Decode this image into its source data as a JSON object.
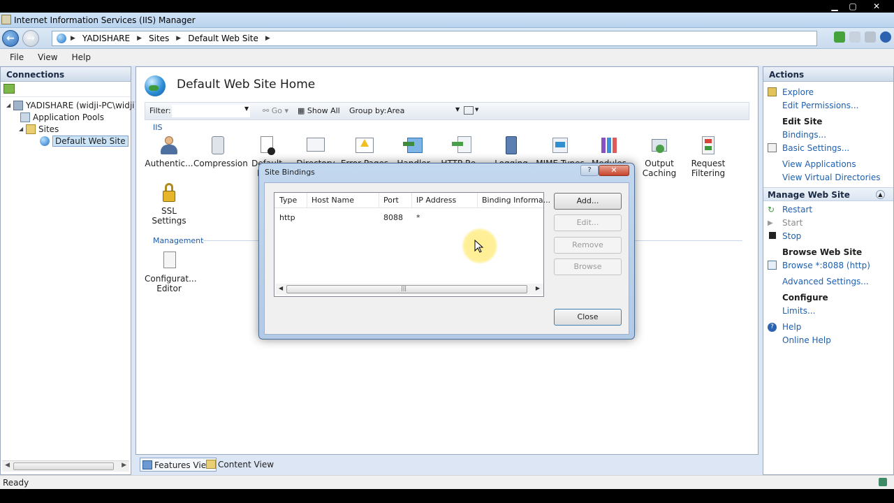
{
  "window": {
    "title": "Internet Information Services (IIS) Manager",
    "minimize": "▁",
    "maximize": "▢",
    "close": "✕"
  },
  "address": {
    "crumbs": [
      "YADISHARE",
      "Sites",
      "Default Web Site"
    ],
    "separator": "▶"
  },
  "menu": [
    "File",
    "View",
    "Help"
  ],
  "connections": {
    "header": "Connections",
    "tree": [
      {
        "label": "YADISHARE (widji-PC\\widji)",
        "icon": "server-icon"
      },
      {
        "label": "Application Pools",
        "icon": "app-pools-icon"
      },
      {
        "label": "Sites",
        "icon": "sites-folder-icon"
      },
      {
        "label": "Default Web Site",
        "icon": "globe-icon",
        "selected": true
      }
    ]
  },
  "center": {
    "title": "Default Web Site Home",
    "filter_label": "Filter:",
    "go_label": "Go",
    "show_all_label": "Show All",
    "group_by_label": "Group by:",
    "group_by_value": "Area",
    "sections": {
      "iis": "IIS",
      "management": "Management"
    },
    "features": [
      {
        "label": "Authentic...",
        "icon": "authentication-icon"
      },
      {
        "label": "Compression",
        "icon": "compression-icon"
      },
      {
        "label": "Default Do...",
        "icon": "default-document-icon"
      },
      {
        "label": "Directory Browsing",
        "icon": "directory-browsing-icon"
      },
      {
        "label": "Error Pages",
        "icon": "error-pages-icon"
      },
      {
        "label": "Handler Mappings",
        "icon": "handler-mappings-icon"
      },
      {
        "label": "HTTP Re...",
        "icon": "http-response-icon"
      },
      {
        "label": "Logging",
        "icon": "logging-icon"
      },
      {
        "label": "MIME Types",
        "icon": "mime-types-icon"
      },
      {
        "label": "Modules",
        "icon": "modules-icon"
      },
      {
        "label": "Output Caching",
        "icon": "output-caching-icon"
      },
      {
        "label": "Request Filtering",
        "icon": "request-filtering-icon"
      },
      {
        "label": "SSL Settings",
        "icon": "ssl-lock-icon"
      }
    ],
    "management_features": [
      {
        "label": "Configurat... Editor",
        "icon": "configuration-editor-icon"
      }
    ],
    "tabs": {
      "features_view": "Features View",
      "content_view": "Content View"
    }
  },
  "actions": {
    "header": "Actions",
    "explore": "Explore",
    "edit_permissions": "Edit Permissions...",
    "edit_site_heading": "Edit Site",
    "bindings": "Bindings...",
    "basic_settings": "Basic Settings...",
    "view_applications": "View Applications",
    "view_virtual_directories": "View Virtual Directories",
    "manage_web_site_heading": "Manage Web Site",
    "restart": "Restart",
    "start": "Start",
    "stop": "Stop",
    "browse_web_site_heading": "Browse Web Site",
    "browse_link": "Browse *:8088 (http)",
    "advanced_settings": "Advanced Settings...",
    "configure_heading": "Configure",
    "limits": "Limits...",
    "help": "Help",
    "online_help": "Online Help"
  },
  "status": {
    "text": "Ready"
  },
  "dialog": {
    "title": "Site Bindings",
    "help_symbol": "?",
    "close_symbol": "✕",
    "columns": [
      "Type",
      "Host Name",
      "Port",
      "IP Address",
      "Binding Informa..."
    ],
    "rows": [
      {
        "type": "http",
        "host_name": "",
        "port": "8088",
        "ip_address": "*",
        "binding_info": ""
      }
    ],
    "buttons": {
      "add": "Add...",
      "edit": "Edit...",
      "remove": "Remove",
      "browse": "Browse",
      "close": "Close"
    }
  },
  "colors": {
    "link": "#1d5fb0",
    "accent": "#1e5aa8",
    "selection": "#cce4f7"
  }
}
